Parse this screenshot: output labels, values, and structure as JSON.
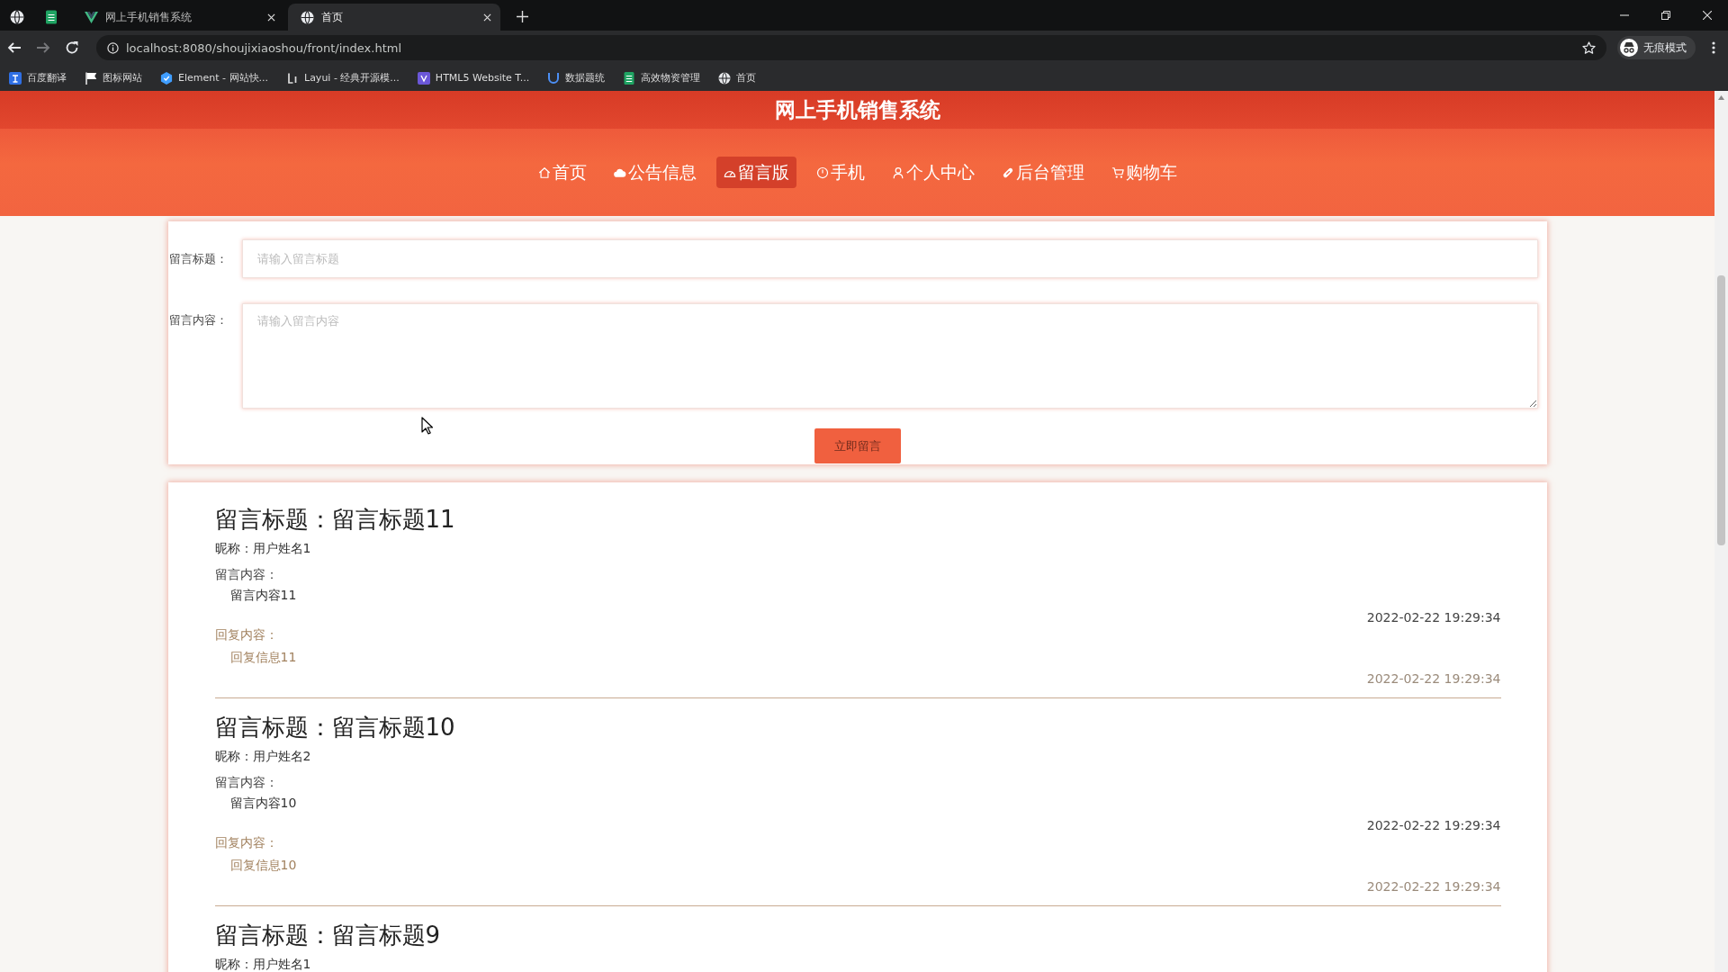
{
  "browser": {
    "tabs": [
      {
        "title": "网上手机销售系统",
        "selected": false
      },
      {
        "title": "首页",
        "selected": true
      }
    ],
    "forward_disabled": true,
    "address": "localhost:8080/shoujixiaoshou/front/index.html",
    "profile": "无痕模式",
    "bookmarks": [
      "百度翻译",
      "图标网站",
      "Element - 网站快...",
      "Layui - 经典开源模...",
      "HTML5 Website T...",
      "数据题统",
      "高效物资管理",
      "首页"
    ]
  },
  "header": {
    "title": "网上手机销售系统",
    "nav": [
      {
        "label": "首页",
        "selected": false
      },
      {
        "label": "公告信息",
        "selected": false
      },
      {
        "label": "留言版",
        "selected": true
      },
      {
        "label": "手机",
        "selected": false
      },
      {
        "label": "个人中心",
        "selected": false
      },
      {
        "label": "后台管理",
        "selected": false
      },
      {
        "label": "购物车",
        "selected": false
      }
    ]
  },
  "form": {
    "fields": [
      {
        "kind": "input",
        "label": "留言标题：",
        "placeholder": "请输入留言标题"
      },
      {
        "kind": "textarea",
        "label": "留言内容：",
        "placeholder": "请输入留言内容"
      }
    ],
    "submit": "立即留言"
  },
  "messages": [
    {
      "title": "留言标题：留言标题11",
      "nickname": "昵称：用户姓名1",
      "content_label": "留言内容：",
      "content": "留言内容11",
      "content_time": "2022-02-22 19:29:34",
      "reply_label": "回复内容：",
      "reply": "回复信息11",
      "reply_time": "2022-02-22 19:29:34"
    },
    {
      "title": "留言标题：留言标题10",
      "nickname": "昵称：用户姓名2",
      "content_label": "留言内容：",
      "content": "留言内容10",
      "content_time": "2022-02-22 19:29:34",
      "reply_label": "回复内容：",
      "reply": "回复信息10",
      "reply_time": "2022-02-22 19:29:34"
    },
    {
      "title": "留言标题：留言标题9",
      "nickname": "昵称：用户姓名1"
    }
  ]
}
